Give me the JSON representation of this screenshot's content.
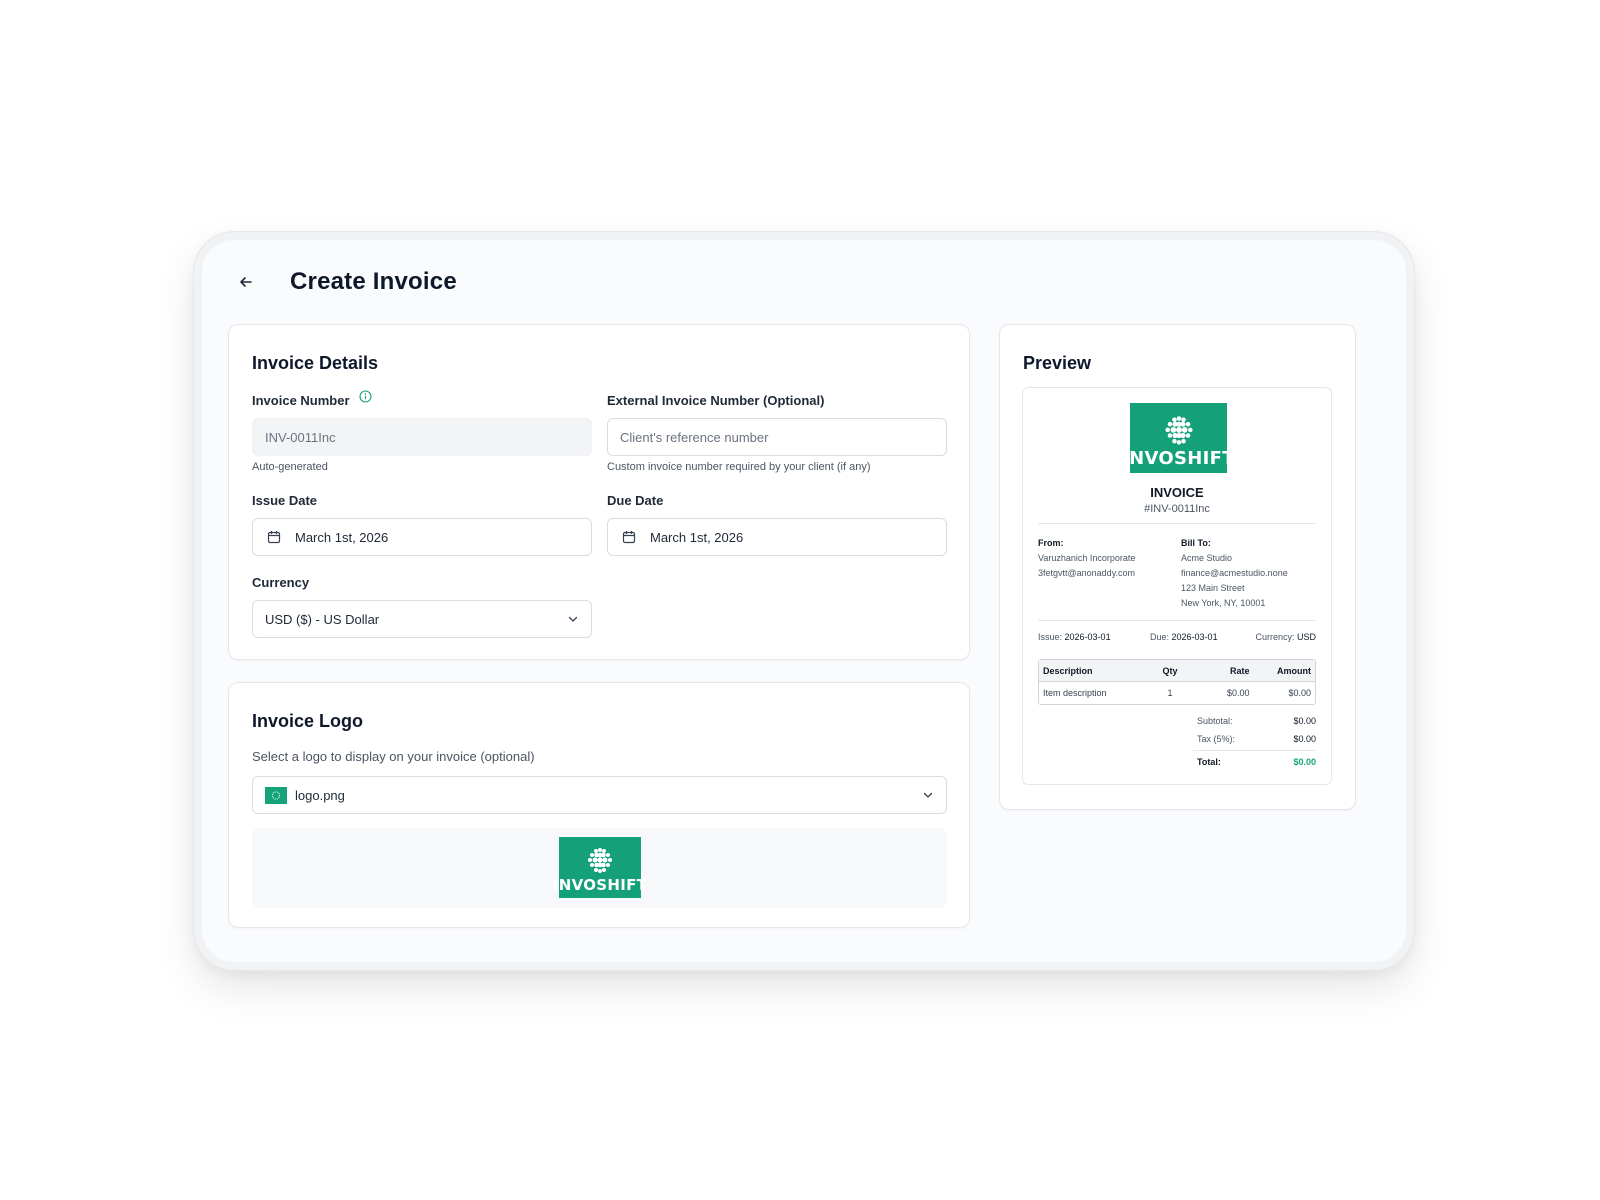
{
  "page": {
    "title": "Create Invoice"
  },
  "details": {
    "title": "Invoice Details",
    "invoice_number_label": "Invoice Number",
    "invoice_number_value": "INV-0011Inc",
    "invoice_number_hint": "Auto-generated",
    "external_label": "External Invoice Number (Optional)",
    "external_placeholder": "Client's reference number",
    "external_hint": "Custom invoice number required by your client (if any)",
    "issue_label": "Issue Date",
    "issue_value": "March 1st, 2026",
    "due_label": "Due Date",
    "due_value": "March 1st, 2026",
    "currency_label": "Currency",
    "currency_value": "USD ($) - US Dollar"
  },
  "logo_section": {
    "title": "Invoice Logo",
    "subtitle": "Select a logo to display on your invoice (optional)",
    "selected_file": "logo.png",
    "logo_text": "INVOSHIFT"
  },
  "preview": {
    "title": "Preview",
    "logo_text": "INVOSHIFT",
    "heading": "INVOICE",
    "number": "#INV-0011Inc",
    "from_label": "From:",
    "from_name": "Varuzhanich Incorporate",
    "from_email": "3fetgvtt@anonaddy.com",
    "bill_label": "Bill To:",
    "bill_name": "Acme Studio",
    "bill_email": "finance@acmestudio.none",
    "bill_street": "123 Main Street",
    "bill_city": "New York, NY, 10001",
    "issue_label": "Issue:",
    "issue_value": "2026-03-01",
    "due_label": "Due:",
    "due_value": "2026-03-01",
    "currency_label": "Currency:",
    "currency_value": "USD",
    "table_headers": [
      "Description",
      "Qty",
      "Rate",
      "Amount"
    ],
    "table_rows": [
      [
        "Item description",
        "1",
        "$0.00",
        "$0.00"
      ]
    ],
    "subtotal_label": "Subtotal:",
    "subtotal_value": "$0.00",
    "tax_label": "Tax (5%):",
    "tax_value": "$0.00",
    "total_label": "Total:",
    "total_value": "$0.00"
  },
  "colors": {
    "brand": "#14a078",
    "total": "#16a37a",
    "text": "#0f172a"
  },
  "icons": {
    "back": "arrow-left-icon",
    "info": "info-circle-icon",
    "calendar": "calendar-icon",
    "chevron": "chevron-down-icon"
  }
}
